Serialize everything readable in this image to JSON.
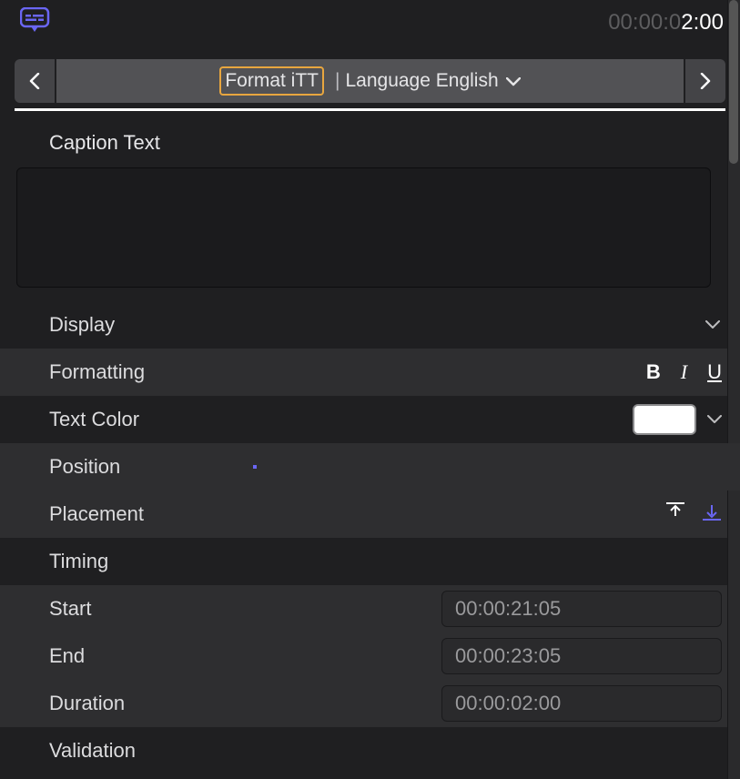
{
  "top_timecode": {
    "dim": "00:00:0",
    "bright": "2:00"
  },
  "nav": {
    "format_label": "Format iTT",
    "separator": "|",
    "language_label": "Language English"
  },
  "caption_section_label": "Caption Text",
  "caption_text_value": "",
  "rows": {
    "display": "Display",
    "formatting": "Formatting",
    "text_color": "Text Color",
    "position": "Position",
    "placement": "Placement",
    "timing": "Timing",
    "start": "Start",
    "end": "End",
    "duration": "Duration",
    "validation": "Validation"
  },
  "format_buttons": {
    "bold": "B",
    "italic": "I",
    "underline": "U"
  },
  "text_color_value": "#FFFFFF",
  "timing": {
    "start": "00:00:21:05",
    "end": "00:00:23:05",
    "duration": "00:00:02:00"
  }
}
